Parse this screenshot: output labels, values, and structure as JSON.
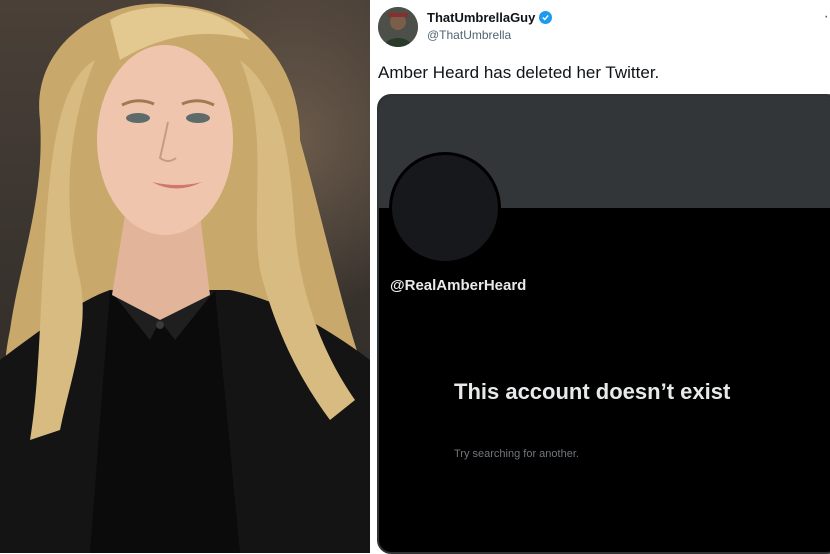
{
  "tweet": {
    "author_name": "ThatUmbrellaGuy",
    "author_handle": "@ThatUmbrella",
    "more_symbol": "·",
    "text": "Amber Heard has deleted her Twitter."
  },
  "embedded_profile": {
    "handle": "@RealAmberHeard",
    "empty_title": "This account doesn’t exist",
    "empty_subtitle": "Try searching for another."
  },
  "colors": {
    "verified": "#1d9bf0",
    "embed_background": "#000000",
    "banner": "#333639"
  },
  "icons": [
    "verified-badge-icon",
    "more-options-icon"
  ]
}
